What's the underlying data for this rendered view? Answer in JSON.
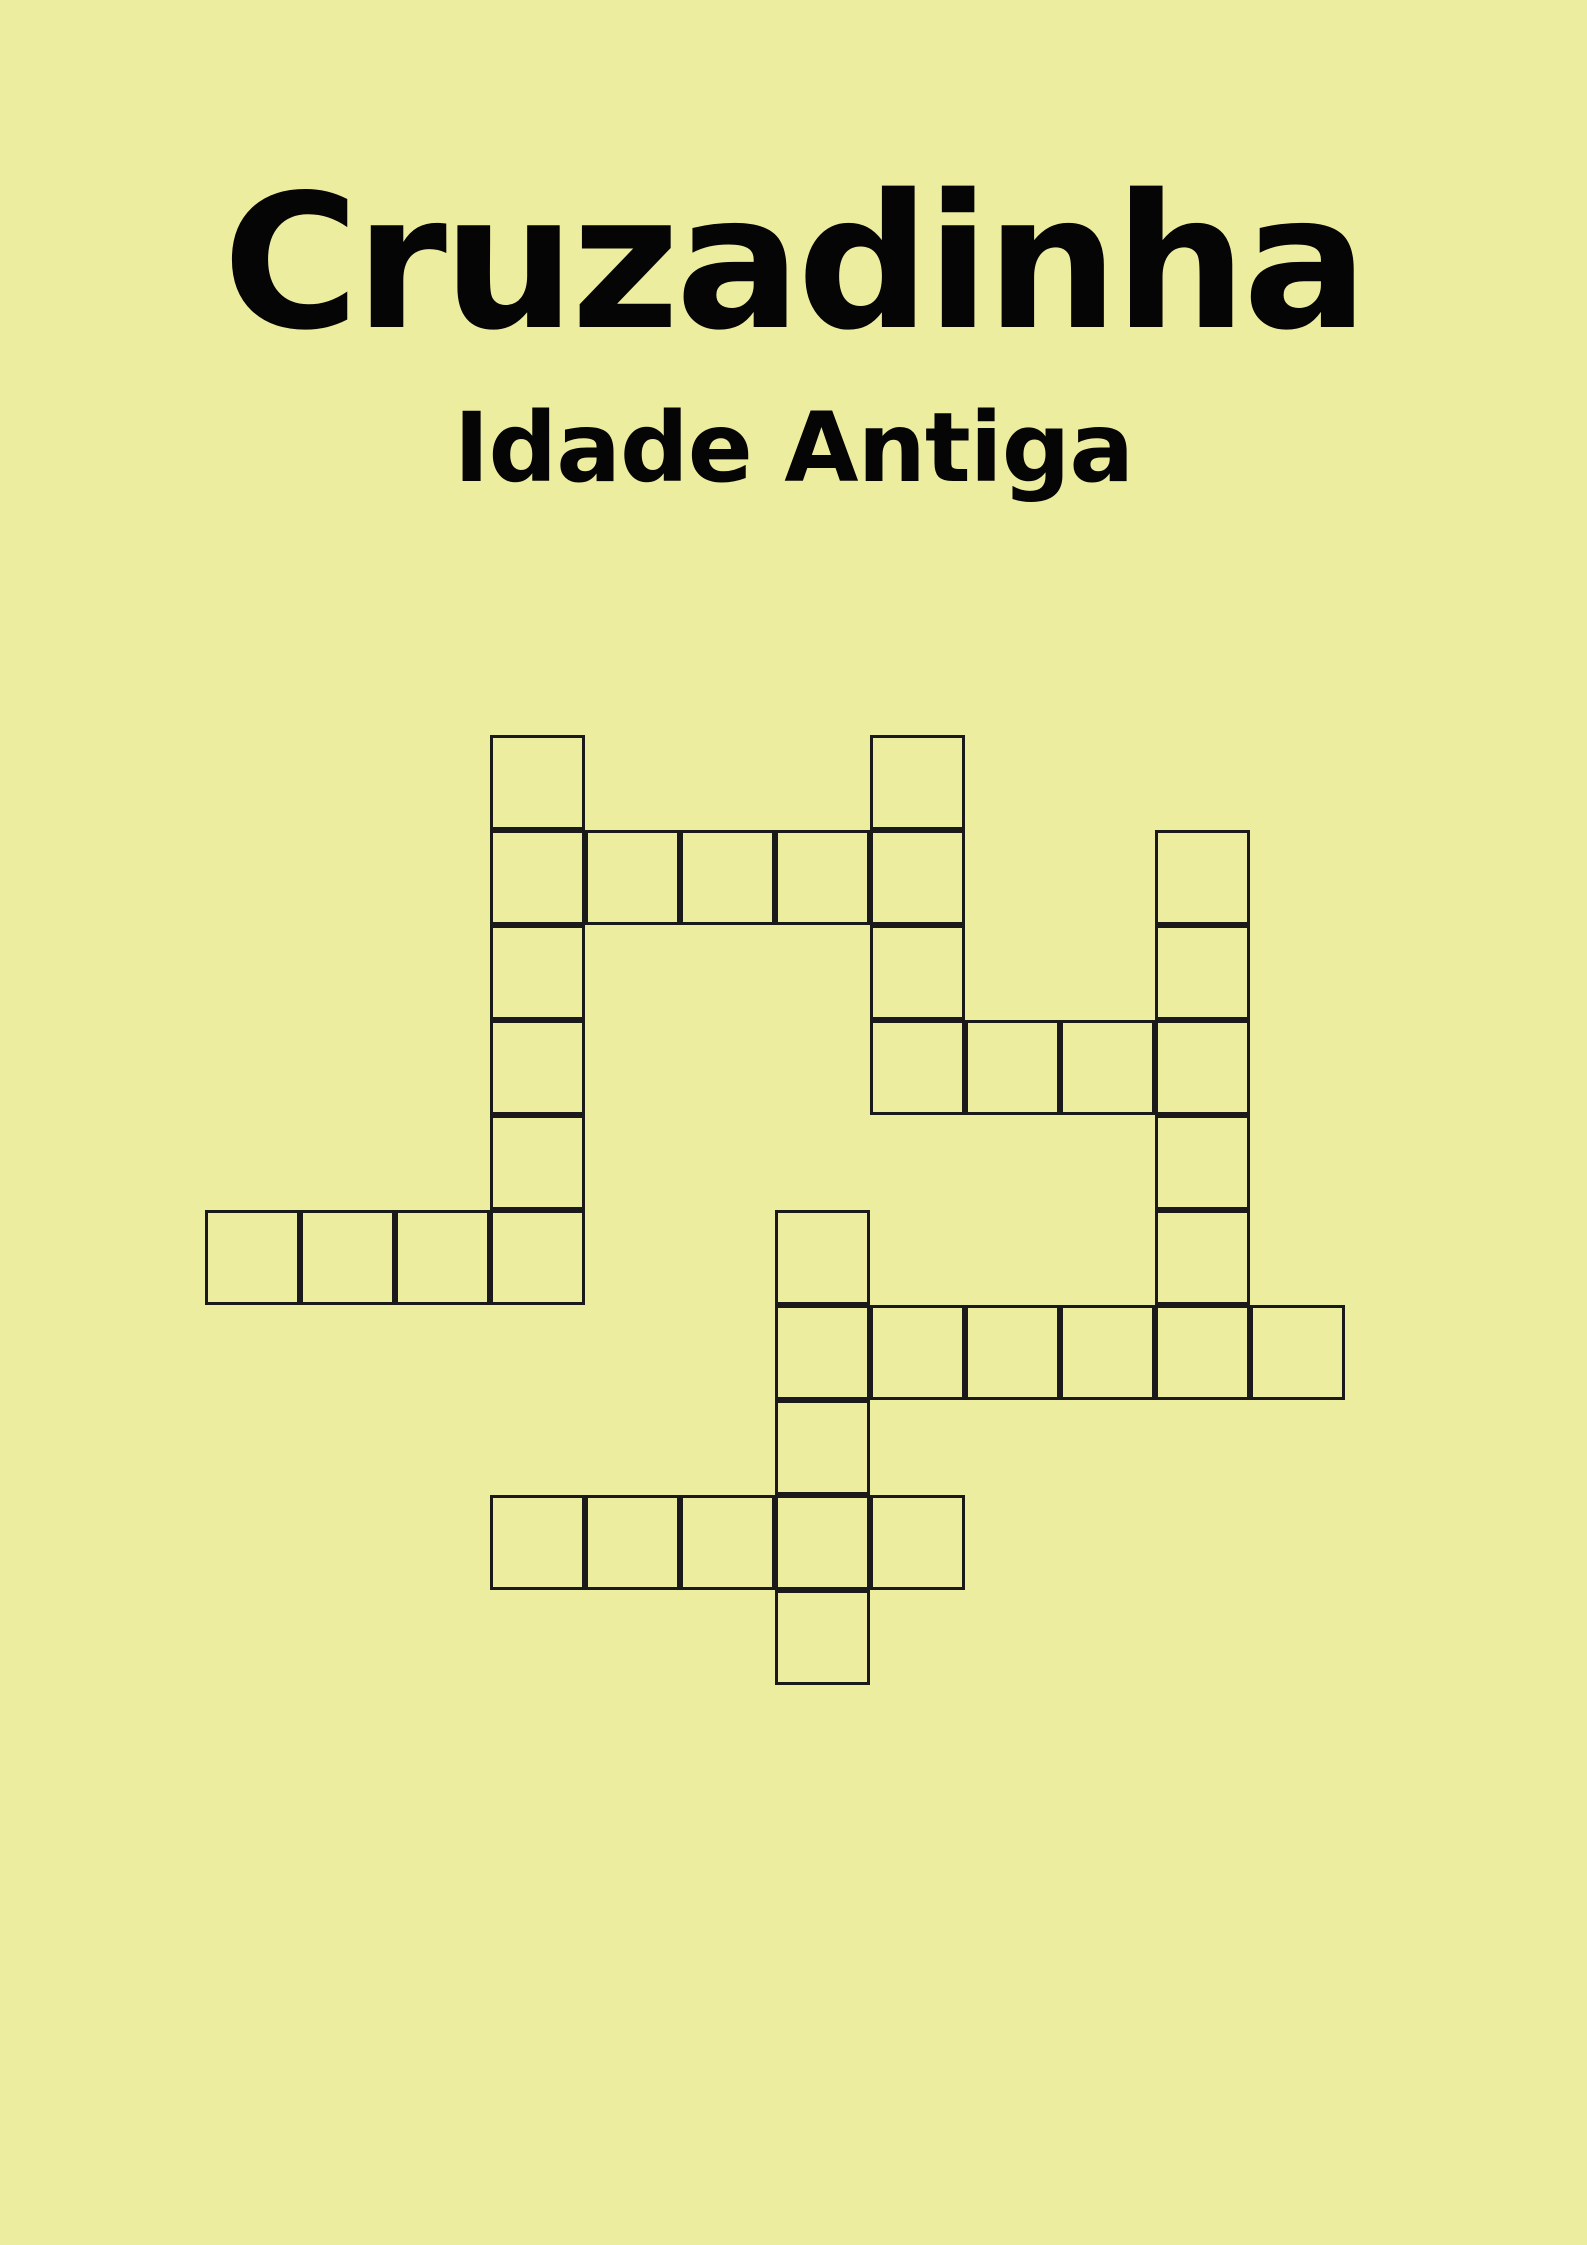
{
  "title": "Cruzadinha",
  "subtitle": "Idade Antiga",
  "colors": {
    "background": "#ededa0",
    "text": "#050505",
    "cell_border": "#1a1a1a"
  },
  "puzzle": {
    "rows": 11,
    "cols": 12,
    "words": [
      {
        "direction": "down",
        "row": 0,
        "col": 3,
        "length": 6
      },
      {
        "direction": "down",
        "row": 0,
        "col": 7,
        "length": 4
      },
      {
        "direction": "across",
        "row": 1,
        "col": 3,
        "length": 5
      },
      {
        "direction": "down",
        "row": 1,
        "col": 10,
        "length": 6
      },
      {
        "direction": "across",
        "row": 3,
        "col": 7,
        "length": 4
      },
      {
        "direction": "across",
        "row": 5,
        "col": 0,
        "length": 4
      },
      {
        "direction": "down",
        "row": 5,
        "col": 6,
        "length": 5
      },
      {
        "direction": "across",
        "row": 6,
        "col": 6,
        "length": 6
      },
      {
        "direction": "across",
        "row": 8,
        "col": 3,
        "length": 5
      }
    ]
  }
}
